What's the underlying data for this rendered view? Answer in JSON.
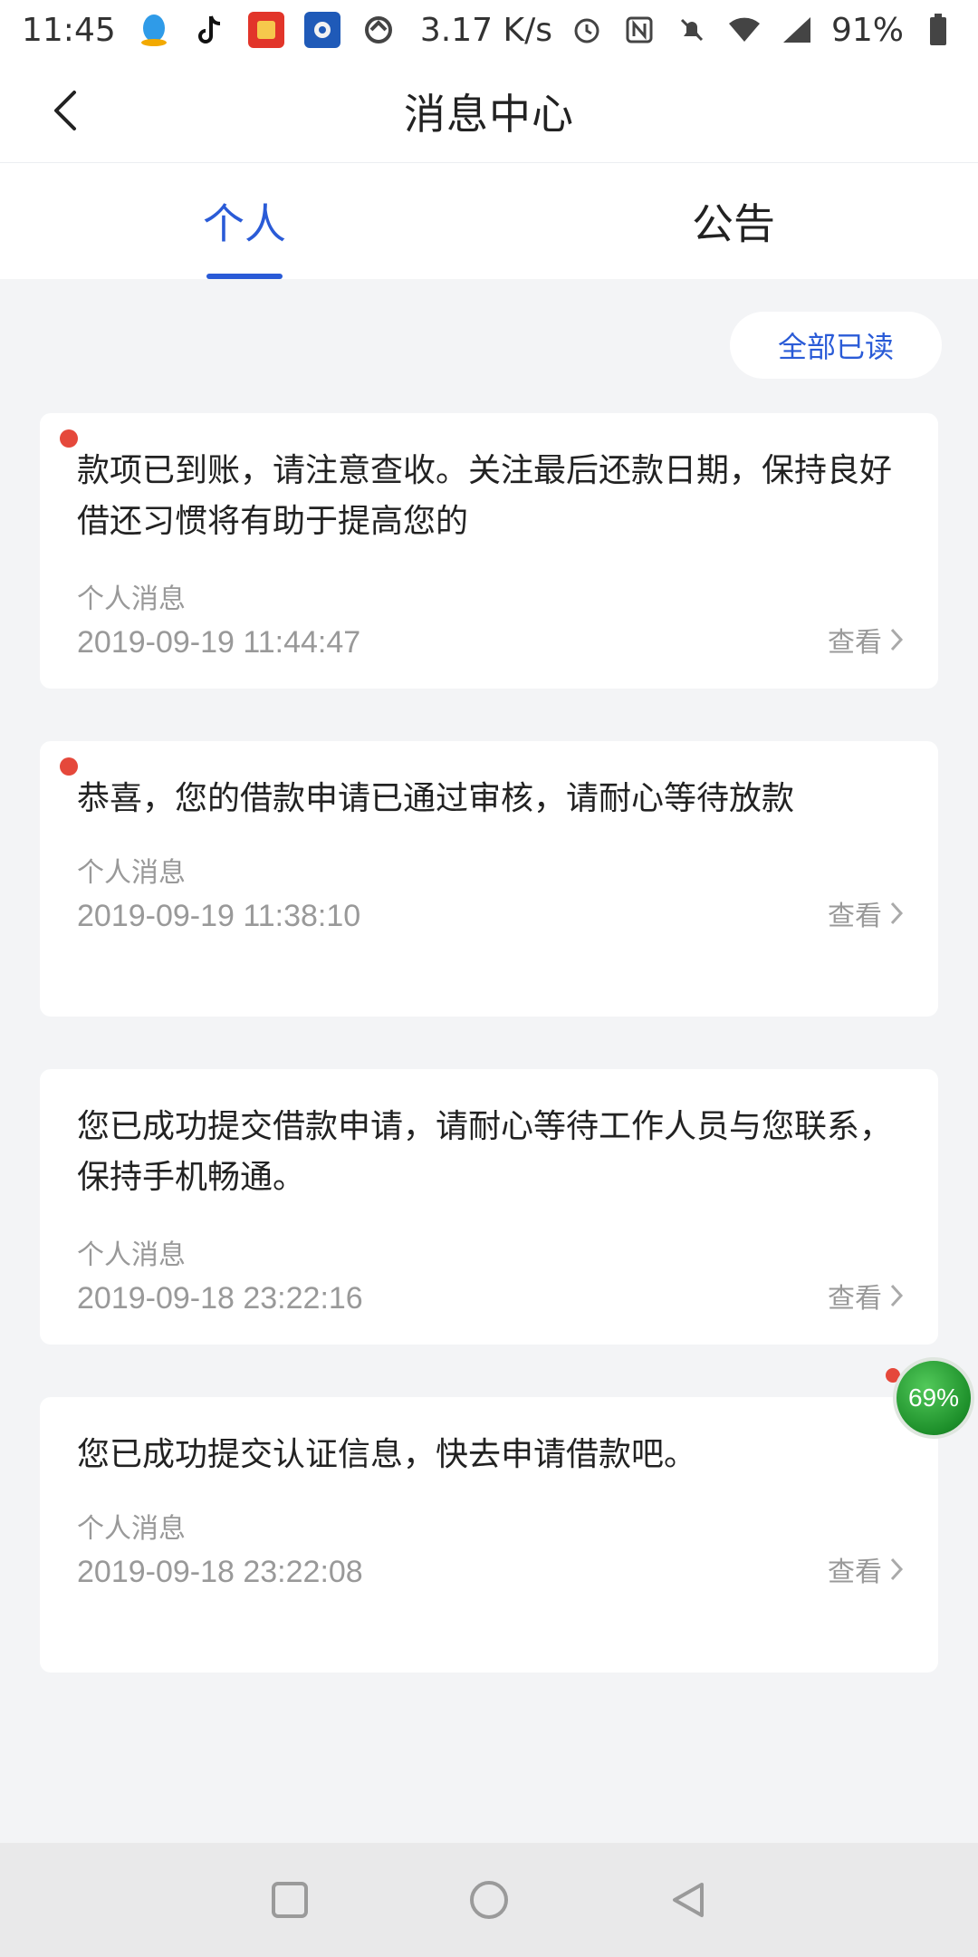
{
  "status_bar": {
    "time": "11:45",
    "network_speed": "3.17 K/s",
    "battery": "91%",
    "apps": [
      "qq-icon",
      "tiktok-icon",
      "app-icon-1",
      "app-icon-2",
      "app-icon-3"
    ]
  },
  "header": {
    "title": "消息中心"
  },
  "tabs": [
    {
      "label": "个人",
      "active": true
    },
    {
      "label": "公告",
      "active": false
    }
  ],
  "mark_all_read": "全部已读",
  "messages": [
    {
      "text": "款项已到账，请注意查收。关注最后还款日期，保持良好借还习惯将有助于提高您的",
      "type": "个人消息",
      "time": "2019-09-19 11:44:47",
      "view": "查看",
      "unread": true
    },
    {
      "text": "恭喜，您的借款申请已通过审核，请耐心等待放款",
      "type": "个人消息",
      "time": "2019-09-19 11:38:10",
      "view": "查看",
      "unread": true
    },
    {
      "text": "您已成功提交借款申请，请耐心等待工作人员与您联系，保持手机畅通。",
      "type": "个人消息",
      "time": "2019-09-18 23:22:16",
      "view": "查看",
      "unread": false
    },
    {
      "text": "您已成功提交认证信息，快去申请借款吧。",
      "type": "个人消息",
      "time": "2019-09-18 23:22:08",
      "view": "查看",
      "unread": false
    }
  ],
  "floating_badge": "69%",
  "colors": {
    "accent": "#2a5bd7",
    "unread_dot": "#e5483b",
    "background": "#f3f4f6"
  }
}
